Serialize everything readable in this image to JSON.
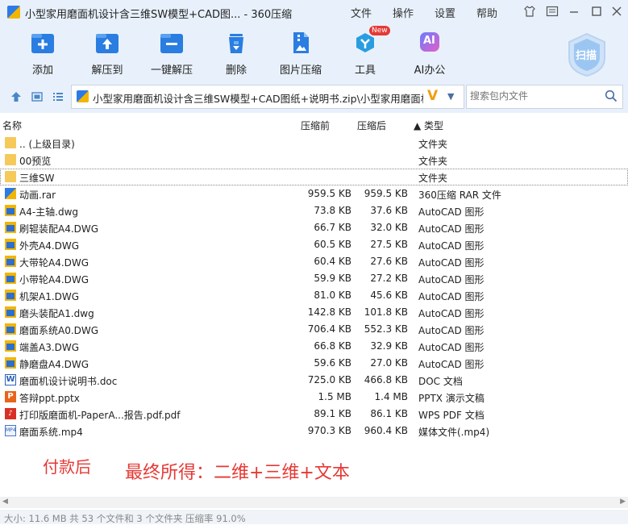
{
  "window": {
    "title": "小型家用磨面机设计含三维SW模型+CAD图... - 360压缩",
    "menus": [
      "文件",
      "操作",
      "设置",
      "帮助"
    ]
  },
  "toolbar": {
    "items": [
      {
        "label": "添加",
        "icon": "add-icon"
      },
      {
        "label": "解压到",
        "icon": "extract-to-icon"
      },
      {
        "label": "一键解压",
        "icon": "one-click-extract-icon"
      },
      {
        "label": "删除",
        "icon": "trash-icon"
      },
      {
        "label": "图片压缩",
        "icon": "image-compress-icon"
      },
      {
        "label": "工具",
        "icon": "tools-icon",
        "badge": "New"
      },
      {
        "label": "AI办公",
        "icon": "ai-icon",
        "badge_text": "AI"
      }
    ],
    "scan_label": "扫描"
  },
  "address": {
    "path": "小型家用磨面机设计含三维SW模型+CAD图纸+说明书.zip\\小型家用磨面机 -",
    "search_placeholder": "搜索包内文件"
  },
  "columns": {
    "name": "名称",
    "compressed_before": "压缩前",
    "compressed_after": "压缩后",
    "type": "▲ 类型"
  },
  "files": [
    {
      "name": ".. (上级目录)",
      "before": "",
      "after": "",
      "type": "文件夹",
      "icon": "folder"
    },
    {
      "name": "00预览",
      "before": "",
      "after": "",
      "type": "文件夹",
      "icon": "folder"
    },
    {
      "name": "三维SW",
      "before": "",
      "after": "",
      "type": "文件夹",
      "icon": "folder",
      "selected": true
    },
    {
      "name": "动画.rar",
      "before": "959.5 KB",
      "after": "959.5 KB",
      "type": "360压缩 RAR 文件",
      "icon": "rar"
    },
    {
      "name": "A4-主轴.dwg",
      "before": "73.8 KB",
      "after": "37.6 KB",
      "type": "AutoCAD 图形",
      "icon": "dwg"
    },
    {
      "name": "刷辊装配A4.DWG",
      "before": "66.7 KB",
      "after": "32.0 KB",
      "type": "AutoCAD 图形",
      "icon": "dwg"
    },
    {
      "name": "外壳A4.DWG",
      "before": "60.5 KB",
      "after": "27.5 KB",
      "type": "AutoCAD 图形",
      "icon": "dwg"
    },
    {
      "name": "大带轮A4.DWG",
      "before": "60.4 KB",
      "after": "27.6 KB",
      "type": "AutoCAD 图形",
      "icon": "dwg"
    },
    {
      "name": "小带轮A4.DWG",
      "before": "59.9 KB",
      "after": "27.2 KB",
      "type": "AutoCAD 图形",
      "icon": "dwg"
    },
    {
      "name": "机架A1.DWG",
      "before": "81.0 KB",
      "after": "45.6 KB",
      "type": "AutoCAD 图形",
      "icon": "dwg"
    },
    {
      "name": "磨头装配A1.dwg",
      "before": "142.8 KB",
      "after": "101.8 KB",
      "type": "AutoCAD 图形",
      "icon": "dwg"
    },
    {
      "name": "磨面系统A0.DWG",
      "before": "706.4 KB",
      "after": "552.3 KB",
      "type": "AutoCAD 图形",
      "icon": "dwg"
    },
    {
      "name": "端盖A3.DWG",
      "before": "66.8 KB",
      "after": "32.9 KB",
      "type": "AutoCAD 图形",
      "icon": "dwg"
    },
    {
      "name": "静磨盘A4.DWG",
      "before": "59.6 KB",
      "after": "27.0 KB",
      "type": "AutoCAD 图形",
      "icon": "dwg"
    },
    {
      "name": "磨面机设计说明书.doc",
      "before": "725.0 KB",
      "after": "466.8 KB",
      "type": "DOC 文档",
      "icon": "doc"
    },
    {
      "name": "答辩ppt.pptx",
      "before": "1.5 MB",
      "after": "1.4 MB",
      "type": "PPTX 演示文稿",
      "icon": "ppt"
    },
    {
      "name": "打印版磨面机-PaperA...报告.pdf.pdf",
      "before": "89.1 KB",
      "after": "86.1 KB",
      "type": "WPS PDF 文档",
      "icon": "pdf"
    },
    {
      "name": "磨面系统.mp4",
      "before": "970.3 KB",
      "after": "960.4 KB",
      "type": "媒体文件(.mp4)",
      "icon": "mp4"
    }
  ],
  "overlay": {
    "text1": "付款后",
    "text2": "最终所得：二维+三维+文本"
  },
  "status": {
    "text": "大小: 11.6 MB 共 53 个文件和 3 个文件夹 压缩率 91.0%"
  },
  "colors": {
    "chrome_bg": "#e8f1fb",
    "accent_blue": "#2c7be5",
    "promo_red": "#e53935"
  }
}
